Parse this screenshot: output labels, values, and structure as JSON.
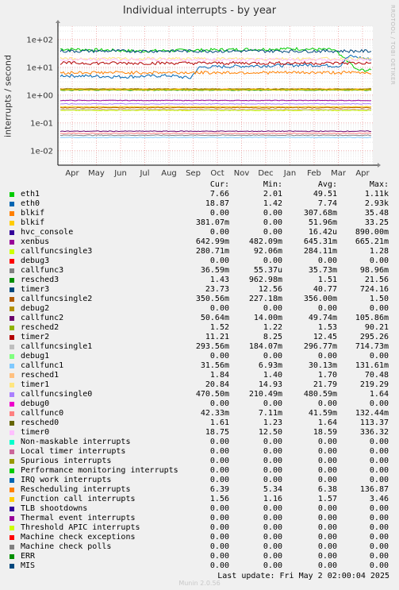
{
  "title": "Individual interrupts - by year",
  "watermark": "RRDTOOL / TOBI OETIKER",
  "ylabel": "interrupts / second",
  "columns": {
    "cur": "Cur:",
    "min": "Min:",
    "avg": "Avg:",
    "max": "Max:"
  },
  "last_update": "Last update: Fri May  2 02:00:04 2025",
  "footer": "Munin 2.0.56",
  "chart_data": {
    "type": "line",
    "title": "Individual interrupts - by year",
    "ylabel": "interrupts / second",
    "yscale": "log",
    "ylim": [
      0.003,
      300
    ],
    "yticks": [
      {
        "v": 0.01,
        "label": "1e-02"
      },
      {
        "v": 0.1,
        "label": "1e-01"
      },
      {
        "v": 1,
        "label": "1e+00"
      },
      {
        "v": 10,
        "label": "1e+01"
      },
      {
        "v": 100,
        "label": "1e+02"
      }
    ],
    "xticks": [
      "Apr",
      "May",
      "Jun",
      "Jul",
      "Aug",
      "Sep",
      "Oct",
      "Nov",
      "Dec",
      "Jan",
      "Feb",
      "Mar",
      "Apr"
    ],
    "grid": true,
    "series": [
      {
        "name": "eth1",
        "color": "#00cc00",
        "cur": "7.66",
        "min": "2.01",
        "avg": "49.51",
        "max": "1.11k",
        "level": 40,
        "shape": [
          [
            0,
            45
          ],
          [
            0.25,
            38
          ],
          [
            0.5,
            42
          ],
          [
            0.75,
            46
          ],
          [
            0.88,
            42
          ],
          [
            0.9,
            25
          ],
          [
            0.95,
            8
          ],
          [
            1,
            7.66
          ]
        ]
      },
      {
        "name": "eth0",
        "color": "#0066b3",
        "cur": "18.87",
        "min": "1.42",
        "avg": "7.74",
        "max": "2.93k",
        "level": 6,
        "shape": [
          [
            0,
            5
          ],
          [
            0.2,
            4.5
          ],
          [
            0.35,
            5
          ],
          [
            0.42,
            4
          ],
          [
            0.45,
            10
          ],
          [
            0.6,
            11
          ],
          [
            0.8,
            12
          ],
          [
            0.9,
            11
          ],
          [
            0.93,
            25
          ],
          [
            1,
            18.87
          ]
        ]
      },
      {
        "name": "blkif",
        "color": "#ff8000",
        "cur": "0.00",
        "min": "0.00",
        "avg": "307.68m",
        "max": "35.48",
        "level": 0.3
      },
      {
        "name": "blkif",
        "color": "#ffcc00",
        "cur": "381.07m",
        "min": "0.00",
        "avg": "51.96m",
        "max": "33.25",
        "level": 0.38
      },
      {
        "name": "hvc_console",
        "color": "#330099",
        "cur": "0.00",
        "min": "0.00",
        "avg": "16.42u",
        "max": "890.00m",
        "level": 0
      },
      {
        "name": "xenbus",
        "color": "#990099",
        "cur": "642.99m",
        "min": "482.09m",
        "avg": "645.31m",
        "max": "665.21m",
        "level": 0.64
      },
      {
        "name": "callfuncsingle3",
        "color": "#ccff00",
        "cur": "280.71m",
        "min": "92.06m",
        "avg": "284.11m",
        "max": "1.28",
        "level": 0.28
      },
      {
        "name": "debug3",
        "color": "#ff0000",
        "cur": "0.00",
        "min": "0.00",
        "avg": "0.00",
        "max": "0.00",
        "level": 0
      },
      {
        "name": "callfunc3",
        "color": "#808080",
        "cur": "36.59m",
        "min": "55.37u",
        "avg": "35.73m",
        "max": "98.96m",
        "level": 0.036
      },
      {
        "name": "resched3",
        "color": "#008f00",
        "cur": "1.43",
        "min": "962.98m",
        "avg": "1.51",
        "max": "21.56",
        "level": 1.5
      },
      {
        "name": "timer3",
        "color": "#00487d",
        "cur": "23.73",
        "min": "12.56",
        "avg": "40.77",
        "max": "724.16",
        "level": 38
      },
      {
        "name": "callfuncsingle2",
        "color": "#b35a00",
        "cur": "350.56m",
        "min": "227.18m",
        "avg": "356.00m",
        "max": "1.50",
        "level": 0.35
      },
      {
        "name": "debug2",
        "color": "#b38f00",
        "cur": "0.00",
        "min": "0.00",
        "avg": "0.00",
        "max": "0.00",
        "level": 0
      },
      {
        "name": "callfunc2",
        "color": "#6b006b",
        "cur": "50.64m",
        "min": "14.00m",
        "avg": "49.74m",
        "max": "105.86m",
        "level": 0.05
      },
      {
        "name": "resched2",
        "color": "#8fb300",
        "cur": "1.52",
        "min": "1.22",
        "avg": "1.53",
        "max": "90.21",
        "level": 1.53
      },
      {
        "name": "timer2",
        "color": "#b30000",
        "cur": "11.21",
        "min": "8.25",
        "avg": "12.45",
        "max": "295.26",
        "level": 14
      },
      {
        "name": "callfuncsingle1",
        "color": "#bebebe",
        "cur": "293.56m",
        "min": "184.07m",
        "avg": "296.77m",
        "max": "714.73m",
        "level": 0.3
      },
      {
        "name": "debug1",
        "color": "#80ff80",
        "cur": "0.00",
        "min": "0.00",
        "avg": "0.00",
        "max": "0.00",
        "level": 0
      },
      {
        "name": "callfunc1",
        "color": "#80c9ff",
        "cur": "31.56m",
        "min": "6.93m",
        "avg": "30.13m",
        "max": "131.61m",
        "level": 0.03
      },
      {
        "name": "resched1",
        "color": "#ffc080",
        "cur": "1.84",
        "min": "1.40",
        "avg": "1.70",
        "max": "70.48",
        "level": 1.7
      },
      {
        "name": "timer1",
        "color": "#ffe680",
        "cur": "20.84",
        "min": "14.93",
        "avg": "21.79",
        "max": "219.29",
        "level": 20
      },
      {
        "name": "callfuncsingle0",
        "color": "#aa80ff",
        "cur": "470.50m",
        "min": "210.49m",
        "avg": "480.59m",
        "max": "1.64",
        "level": 0.48
      },
      {
        "name": "debug0",
        "color": "#ee00cc",
        "cur": "0.00",
        "min": "0.00",
        "avg": "0.00",
        "max": "0.00",
        "level": 0
      },
      {
        "name": "callfunc0",
        "color": "#ff8080",
        "cur": "42.33m",
        "min": "7.11m",
        "avg": "41.59m",
        "max": "132.44m",
        "level": 0.042
      },
      {
        "name": "resched0",
        "color": "#666600",
        "cur": "1.61",
        "min": "1.23",
        "avg": "1.64",
        "max": "113.37",
        "level": 1.64
      },
      {
        "name": "timer0",
        "color": "#ffbfff",
        "cur": "18.75",
        "min": "12.50",
        "avg": "18.59",
        "max": "336.32",
        "level": 18.5
      },
      {
        "name": "Non-maskable interrupts",
        "color": "#00ffcc",
        "cur": "0.00",
        "min": "0.00",
        "avg": "0.00",
        "max": "0.00",
        "level": 0
      },
      {
        "name": "Local timer interrupts",
        "color": "#cc6699",
        "cur": "0.00",
        "min": "0.00",
        "avg": "0.00",
        "max": "0.00",
        "level": 0
      },
      {
        "name": "Spurious interrupts",
        "color": "#999900",
        "cur": "0.00",
        "min": "0.00",
        "avg": "0.00",
        "max": "0.00",
        "level": 0
      },
      {
        "name": "Performance monitoring interrupts",
        "color": "#00cc00",
        "cur": "0.00",
        "min": "0.00",
        "avg": "0.00",
        "max": "0.00",
        "level": 0
      },
      {
        "name": "IRQ work interrupts",
        "color": "#0066b3",
        "cur": "0.00",
        "min": "0.00",
        "avg": "0.00",
        "max": "0.00",
        "level": 0
      },
      {
        "name": "Rescheduling interrupts",
        "color": "#ff8000",
        "cur": "6.39",
        "min": "5.34",
        "avg": "6.38",
        "max": "136.87",
        "level": 6.38
      },
      {
        "name": "Function call interrupts",
        "color": "#ffcc00",
        "cur": "1.56",
        "min": "1.16",
        "avg": "1.57",
        "max": "3.46",
        "level": 1.57
      },
      {
        "name": "TLB shootdowns",
        "color": "#330099",
        "cur": "0.00",
        "min": "0.00",
        "avg": "0.00",
        "max": "0.00",
        "level": 0
      },
      {
        "name": "Thermal event interrupts",
        "color": "#990099",
        "cur": "0.00",
        "min": "0.00",
        "avg": "0.00",
        "max": "0.00",
        "level": 0
      },
      {
        "name": "Threshold APIC interrupts",
        "color": "#ccff00",
        "cur": "0.00",
        "min": "0.00",
        "avg": "0.00",
        "max": "0.00",
        "level": 0
      },
      {
        "name": "Machine check exceptions",
        "color": "#ff0000",
        "cur": "0.00",
        "min": "0.00",
        "avg": "0.00",
        "max": "0.00",
        "level": 0
      },
      {
        "name": "Machine check polls",
        "color": "#808080",
        "cur": "0.00",
        "min": "0.00",
        "avg": "0.00",
        "max": "0.00",
        "level": 0
      },
      {
        "name": "ERR",
        "color": "#008f00",
        "cur": "0.00",
        "min": "0.00",
        "avg": "0.00",
        "max": "0.00",
        "level": 0
      },
      {
        "name": "MIS",
        "color": "#00487d",
        "cur": "0.00",
        "min": "0.00",
        "avg": "0.00",
        "max": "0.00",
        "level": 0
      }
    ]
  }
}
